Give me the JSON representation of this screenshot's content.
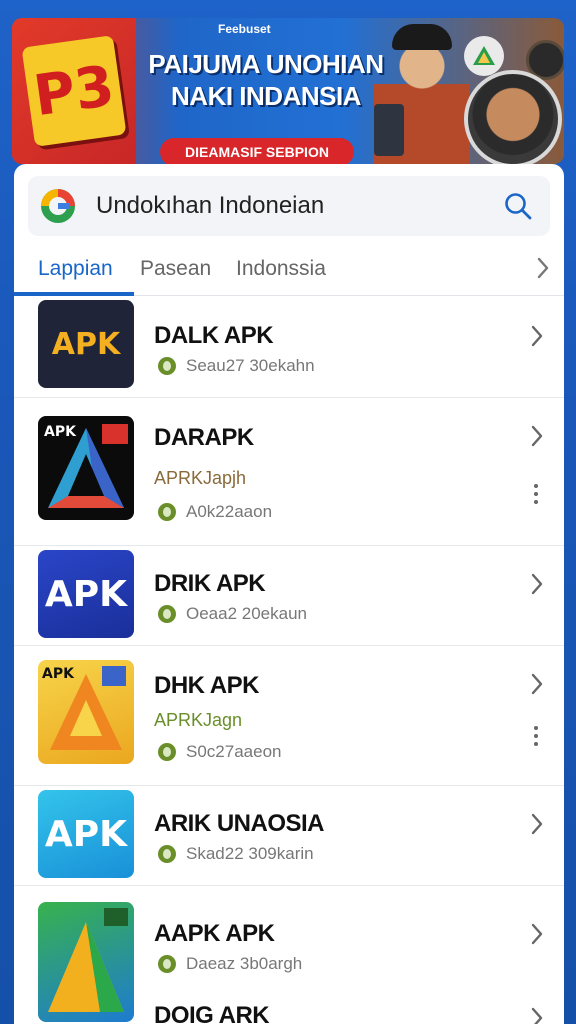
{
  "banner": {
    "small_text": "Feebuset",
    "title_line1": "PAIJUMA UNOHIAN",
    "title_line2": "NAKI INDANSIA",
    "pill": "DIEAMASIF SEBPION",
    "logo_text": "P3"
  },
  "search": {
    "value": "Undokıhan Indoneian"
  },
  "tabs": [
    {
      "label": "Lappian",
      "active": true
    },
    {
      "label": "Pasean",
      "active": false
    },
    {
      "label": "Indonssia",
      "active": false
    }
  ],
  "apps": [
    {
      "name": "DALK APK",
      "sub": "",
      "meta": "Seau27 30ekahn",
      "icon_text": "APK",
      "icon_style": "dark"
    },
    {
      "name": "DARAPK",
      "sub": "APRKJapjh",
      "meta": "A0k22aaon",
      "icon_text": "APK",
      "icon_style": "black-triangle"
    },
    {
      "name": "DRIK APK",
      "sub": "",
      "meta": "Oeaa2 20ekaun",
      "icon_text": "APK",
      "icon_style": "blue"
    },
    {
      "name": "DHK APK",
      "sub": "APRKJagn",
      "meta": "S0c27aaeon",
      "icon_text": "APK",
      "icon_style": "yellow"
    },
    {
      "name": "ARIK UNAOSIA",
      "sub": "",
      "meta": "Skad22 309karin",
      "icon_text": "APK",
      "icon_style": "sky"
    },
    {
      "name": "AAPK APK",
      "sub": "",
      "meta": "Daeaz 3b0argh",
      "icon_text": "",
      "icon_style": "green"
    },
    {
      "name": "DOIG ARK",
      "sub": "",
      "meta": "",
      "icon_text": "",
      "icon_style": ""
    }
  ],
  "icons": {
    "search": "search-icon",
    "chevron": "chevron-right-icon",
    "more": "more-vertical-icon",
    "app_logo": "google-g-icon"
  },
  "colors": {
    "accent": "#1a66c8",
    "background": "#1e63c9",
    "status_dot": "#6a8f2a"
  }
}
